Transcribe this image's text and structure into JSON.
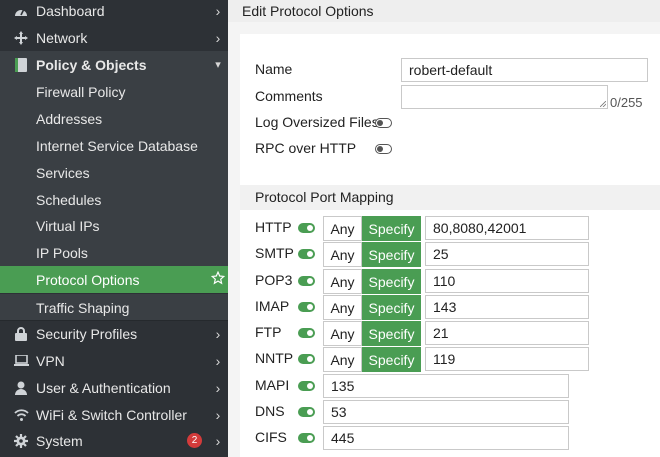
{
  "sidebar": {
    "items": [
      {
        "label": "Dashboard",
        "icon": "dashboard-icon"
      },
      {
        "label": "Network",
        "icon": "network-icon"
      },
      {
        "label": "Policy & Objects",
        "icon": "policy-icon"
      },
      {
        "label": "Firewall Policy"
      },
      {
        "label": "Addresses"
      },
      {
        "label": "Internet Service Database"
      },
      {
        "label": "Services"
      },
      {
        "label": "Schedules"
      },
      {
        "label": "Virtual IPs"
      },
      {
        "label": "IP Pools"
      },
      {
        "label": "Protocol Options"
      },
      {
        "label": "Traffic Shaping"
      },
      {
        "label": "Security Profiles",
        "icon": "lock-icon"
      },
      {
        "label": "VPN",
        "icon": "laptop-icon"
      },
      {
        "label": "User & Authentication",
        "icon": "user-icon"
      },
      {
        "label": "WiFi & Switch Controller",
        "icon": "wifi-icon"
      },
      {
        "label": "System",
        "icon": "gear-icon",
        "badge": "2"
      }
    ],
    "active_item": "Protocol Options"
  },
  "page": {
    "title": "Edit Protocol Options"
  },
  "form": {
    "name_label": "Name",
    "name_value": "robert-default",
    "comments_label": "Comments",
    "comments_counter": "0/255",
    "log_oversized_label": "Log Oversized Files",
    "log_oversized_on": false,
    "rpc_label": "RPC over HTTP",
    "rpc_on": false
  },
  "mapping": {
    "section_title": "Protocol Port Mapping",
    "any_label": "Any",
    "specify_label": "Specify",
    "rows": [
      {
        "proto": "HTTP",
        "ports": "80,8080,42001",
        "mode": "specify",
        "enabled": true
      },
      {
        "proto": "SMTP",
        "ports": "25",
        "mode": "specify",
        "enabled": true
      },
      {
        "proto": "POP3",
        "ports": "110",
        "mode": "specify",
        "enabled": true
      },
      {
        "proto": "IMAP",
        "ports": "143",
        "mode": "specify",
        "enabled": true
      },
      {
        "proto": "FTP",
        "ports": "21",
        "mode": "specify",
        "enabled": true
      },
      {
        "proto": "NNTP",
        "ports": "119",
        "mode": "specify",
        "enabled": true
      },
      {
        "proto": "MAPI",
        "ports": "135",
        "enabled": true
      },
      {
        "proto": "DNS",
        "ports": "53",
        "enabled": true
      },
      {
        "proto": "CIFS",
        "ports": "445",
        "enabled": true
      }
    ]
  },
  "colors": {
    "accent": "#4a9d53",
    "sidebar_bg": "#2d3136",
    "badge": "#d43b3b"
  }
}
